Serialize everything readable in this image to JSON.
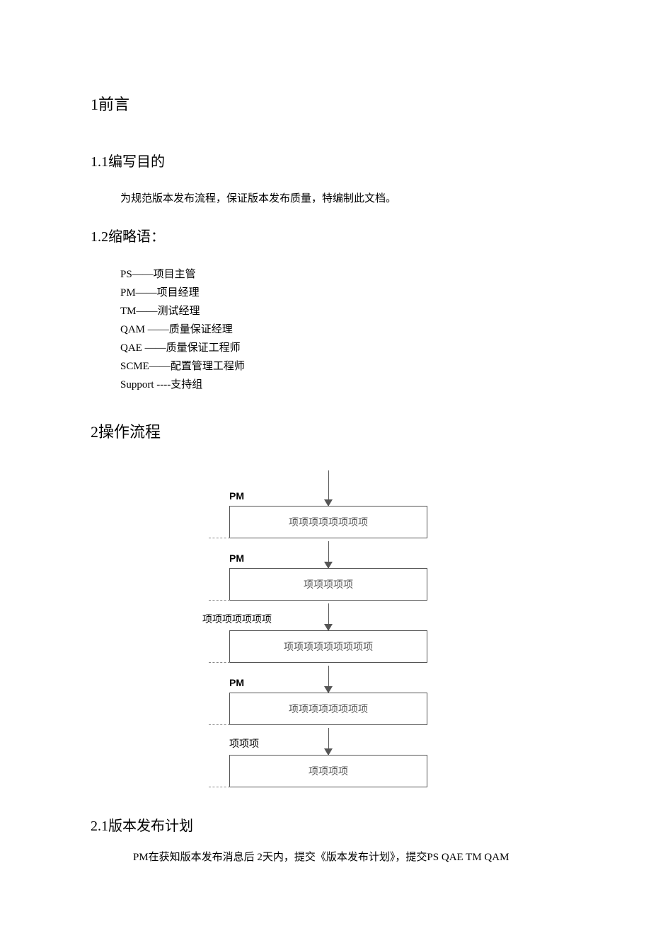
{
  "sections": {
    "s1": {
      "title": "1前言"
    },
    "s1_1": {
      "title": "1.1编写目的",
      "para": "为规范版本发布流程，保证版本发布质量，特编制此文档。"
    },
    "s1_2": {
      "title": "1.2缩略语：",
      "items": [
        "PS——项目主管",
        "PM——项目经理",
        "TM——测试经理",
        "QAM ——质量保证经理",
        "QAE ——质量保证工程师",
        "SCME——配置管理工程师",
        "Support ----支持组"
      ]
    },
    "s2": {
      "title": "2操作流程"
    },
    "s2_1": {
      "title": "2.1版本发布计划",
      "para": "PM在获知版本发布消息后 2天内，提交《版本发布计划》，提交PS QAE TM QAM"
    }
  },
  "flow": {
    "steps": [
      {
        "role": "PM",
        "roleClass": "",
        "box": "项项项项项项项项"
      },
      {
        "role": "PM",
        "roleClass": "",
        "box": "项项项项项"
      },
      {
        "role": "项项项项项项项",
        "roleClass": "cn",
        "box": "项项项项项项项项项"
      },
      {
        "role": "PM",
        "roleClass": "",
        "box": "项项项项项项项项"
      },
      {
        "role": "项项项",
        "roleClass": "cn3",
        "box": "项项项项"
      }
    ]
  }
}
